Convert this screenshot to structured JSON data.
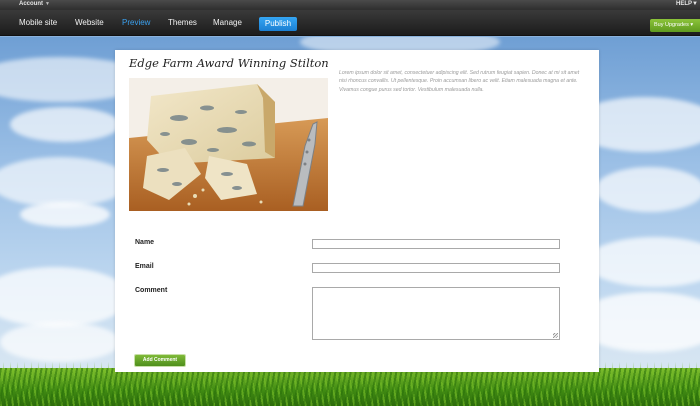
{
  "account_bar": {
    "account_label": "Account",
    "help_label": "HELP"
  },
  "nav": {
    "items": [
      "Mobile site",
      "Website",
      "Preview",
      "Themes",
      "Manage"
    ],
    "active": "Preview",
    "publish_label": "Publish",
    "buy_upgrades_label": "Buy Upgrades"
  },
  "colors": {
    "nav_active": "#3aa0ee",
    "publish": "#1b7fd2",
    "buy_upgrades": "#5f9a1f",
    "add_comment": "#4f8f1c"
  },
  "page": {
    "title": "Edge Farm Award Winning Stilton",
    "image_alt": "Blue Stilton cheese on a wooden board with a cheese knife",
    "body_text": "Lorem ipsum dolor sit amet, consectetuer adipiscing elit. Sed rutrum feugiat sapien. Donec at mi sit amet nisi rhoncus convallis. Ut pellentesque. Proin accumsan libero ac velit. Etiam malesuada magna et ante. Vivamus congue purus sed tortor. Vestibulum malesuada nulla."
  },
  "form": {
    "name_label": "Name",
    "email_label": "Email",
    "comment_label": "Comment",
    "name_value": "",
    "email_value": "",
    "comment_value": "",
    "submit_label": "Add Comment"
  }
}
